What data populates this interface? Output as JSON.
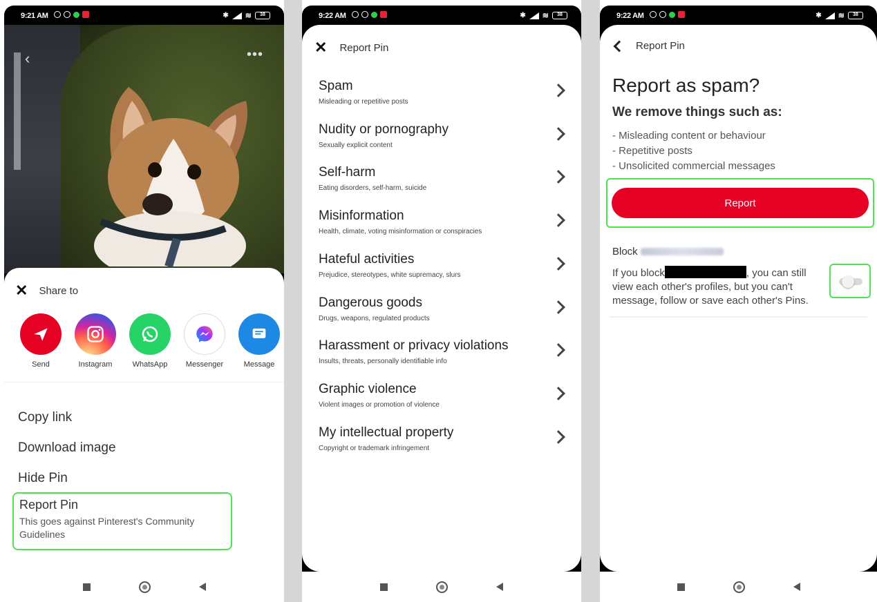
{
  "screen1": {
    "status": {
      "time": "9:21 AM",
      "battery": "38"
    },
    "share_title": "Share to",
    "apps": [
      {
        "label": "Send",
        "icon": "send-arrow-icon",
        "color": "#e60023"
      },
      {
        "label": "Instagram",
        "icon": "instagram-icon",
        "color": "#d6249f"
      },
      {
        "label": "WhatsApp",
        "icon": "whatsapp-icon",
        "color": "#25d366"
      },
      {
        "label": "Messenger",
        "icon": "messenger-icon",
        "color": "#ffffff"
      },
      {
        "label": "Message",
        "icon": "message-icon",
        "color": "#1e88e5"
      }
    ],
    "menu": {
      "copy_link": "Copy link",
      "download_image": "Download image",
      "hide_pin": "Hide Pin",
      "report_pin": "Report Pin",
      "report_pin_sub": "This goes against Pinterest's Community Guidelines"
    }
  },
  "screen2": {
    "status": {
      "time": "9:22 AM",
      "battery": "38"
    },
    "title": "Report Pin",
    "reasons": [
      {
        "title": "Spam",
        "sub": "Misleading or repetitive posts"
      },
      {
        "title": "Nudity or pornography",
        "sub": "Sexually explicit content"
      },
      {
        "title": "Self-harm",
        "sub": "Eating disorders, self-harm, suicide"
      },
      {
        "title": "Misinformation",
        "sub": "Health, climate, voting misinformation or conspiracies"
      },
      {
        "title": "Hateful activities",
        "sub": "Prejudice, stereotypes, white supremacy, slurs"
      },
      {
        "title": "Dangerous goods",
        "sub": "Drugs, weapons, regulated products"
      },
      {
        "title": "Harassment or privacy violations",
        "sub": "Insults, threats, personally identifiable info"
      },
      {
        "title": "Graphic violence",
        "sub": "Violent images or promotion of violence"
      },
      {
        "title": "My intellectual property",
        "sub": "Copyright or trademark infringement"
      }
    ]
  },
  "screen3": {
    "status": {
      "time": "9:22 AM",
      "battery": "38"
    },
    "title": "Report Pin",
    "heading": "Report as spam?",
    "subheading": "We remove things such as:",
    "list": [
      "- Misleading content or behaviour",
      "- Repetitive posts",
      "- Unsolicited commercial messages"
    ],
    "report_button": "Report",
    "block_label": "Block",
    "block_text_1": "If you block",
    "block_text_2": ", you can still view each other's profiles, but you can't message, follow or save each other's Pins.",
    "toggle_on": false
  }
}
